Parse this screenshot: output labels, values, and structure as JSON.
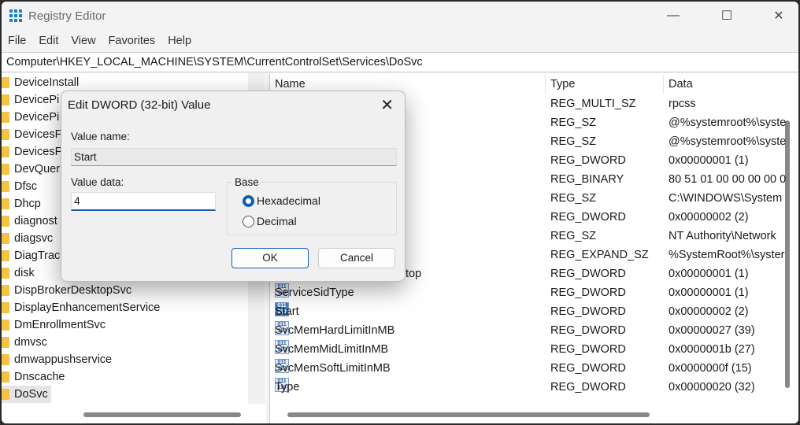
{
  "window": {
    "title": "Registry Editor",
    "minimize": "—",
    "maximize": "☐",
    "close": "✕"
  },
  "menu": [
    "File",
    "Edit",
    "View",
    "Favorites",
    "Help"
  ],
  "address": "Computer\\HKEY_LOCAL_MACHINE\\SYSTEM\\CurrentControlSet\\Services\\DoSvc",
  "tree": [
    "DeviceInstall",
    "DevicePi",
    "DevicePi",
    "DevicesF",
    "DevicesF",
    "DevQuer",
    "Dfsc",
    "Dhcp",
    "diagnost",
    "diagsvc",
    "DiagTrac",
    "disk",
    "DispBrokerDesktopSvc",
    "DisplayEnhancementService",
    "DmEnrollmentSvc",
    "dmvsc",
    "dmwappushservice",
    "Dnscache",
    "DoSvc"
  ],
  "tree_selected": "DoSvc",
  "columns": {
    "name": "Name",
    "type": "Type",
    "data": "Data"
  },
  "values": [
    {
      "name": "",
      "type": "REG_MULTI_SZ",
      "data": "rpcss"
    },
    {
      "name": "",
      "type": "REG_SZ",
      "data": "@%systemroot%\\syste"
    },
    {
      "name": "",
      "type": "REG_SZ",
      "data": "@%systemroot%\\syste"
    },
    {
      "name": "",
      "type": "REG_DWORD",
      "data": "0x00000001 (1)"
    },
    {
      "name": "",
      "type": "REG_BINARY",
      "data": "80 51 01 00 00 00 00 0"
    },
    {
      "name": "",
      "type": "REG_SZ",
      "data": "C:\\WINDOWS\\System"
    },
    {
      "name": "",
      "type": "REG_DWORD",
      "data": "0x00000002 (2)"
    },
    {
      "name": "",
      "type": "REG_SZ",
      "data": "NT Authority\\Network"
    },
    {
      "name": "",
      "type": "REG_EXPAND_SZ",
      "data": "%SystemRoot%\\syster"
    },
    {
      "name": "top",
      "type": "REG_DWORD",
      "data": "0x00000001 (1)"
    },
    {
      "name": "ServiceSidType",
      "type": "REG_DWORD",
      "data": "0x00000001 (1)"
    },
    {
      "name": "Start",
      "type": "REG_DWORD",
      "data": "0x00000002 (2)"
    },
    {
      "name": "SvcMemHardLimitInMB",
      "type": "REG_DWORD",
      "data": "0x00000027 (39)"
    },
    {
      "name": "SvcMemMidLimitInMB",
      "type": "REG_DWORD",
      "data": "0x0000001b (27)"
    },
    {
      "name": "SvcMemSoftLimitInMB",
      "type": "REG_DWORD",
      "data": "0x0000000f (15)"
    },
    {
      "name": "Type",
      "type": "REG_DWORD",
      "data": "0x00000020 (32)"
    }
  ],
  "dialog": {
    "title": "Edit DWORD (32-bit) Value",
    "close": "✕",
    "value_name_label": "Value name:",
    "value_name": "Start",
    "value_data_label": "Value data:",
    "value_data": "4",
    "base_label": "Base",
    "hex": "Hexadecimal",
    "dec": "Decimal",
    "base_selected": "Hexadecimal",
    "ok": "OK",
    "cancel": "Cancel"
  }
}
